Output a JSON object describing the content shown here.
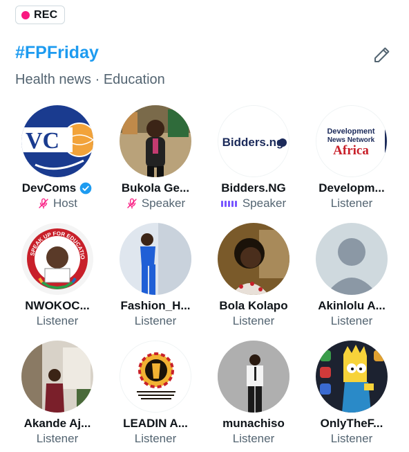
{
  "rec": {
    "label": "REC"
  },
  "space": {
    "title": "#FPFriday",
    "topics": "Health news · Education"
  },
  "participants": [
    {
      "name": "DevComs",
      "role": "Host",
      "verified": true,
      "status_icon": "mic-off-icon"
    },
    {
      "name": "Bukola Ge...",
      "role": "Speaker",
      "status_icon": "mic-off-icon"
    },
    {
      "name": "Bidders.NG",
      "role": "Speaker",
      "status_icon": "speaking-bars-icon"
    },
    {
      "name": "Developm...",
      "role": "Listener"
    },
    {
      "name": "NWOKOC...",
      "role": "Listener"
    },
    {
      "name": "Fashion_H...",
      "role": "Listener"
    },
    {
      "name": "Bola Kolapo",
      "role": "Listener"
    },
    {
      "name": "Akinlolu A...",
      "role": "Listener"
    },
    {
      "name": "Akande Aj...",
      "role": "Listener"
    },
    {
      "name": "LEADIN A...",
      "role": "Listener"
    },
    {
      "name": "munachiso",
      "role": "Listener"
    },
    {
      "name": "OnlyTheF...",
      "role": "Listener"
    }
  ],
  "logos": {
    "devcoms": "VC",
    "bidders": "Bidders.ng",
    "development_line1": "Development",
    "development_line2": "News Network",
    "development_line3": "Africa",
    "speak_up": "SPEAK UP FOR EDUCATION"
  },
  "colors": {
    "accent": "#1d9bf0",
    "rec_dot": "#f91880",
    "speaking": "#7856ff",
    "muted_text": "#536471"
  }
}
